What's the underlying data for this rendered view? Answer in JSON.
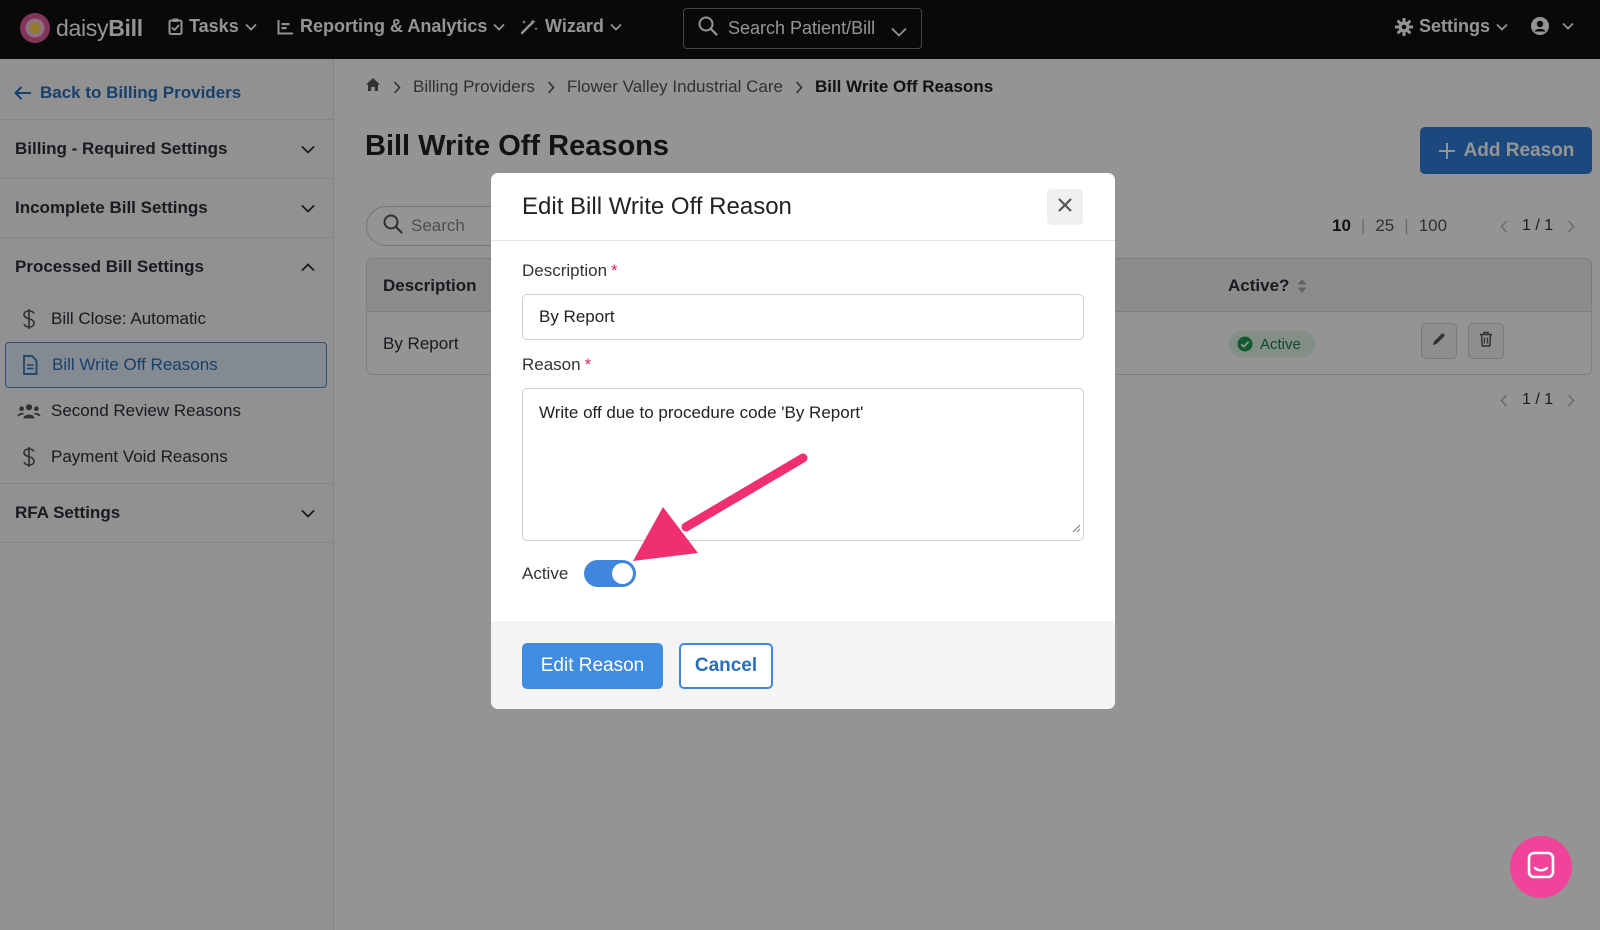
{
  "app": {
    "logo_text_light": "daisy",
    "logo_text_bold": "Bill"
  },
  "topnav": {
    "tasks": "Tasks",
    "reporting": "Reporting & Analytics",
    "wizard": "Wizard",
    "search_placeholder": "Search Patient/Bill",
    "settings": "Settings"
  },
  "sidebar": {
    "back": "Back to Billing Providers",
    "sections": [
      {
        "label": "Billing - Required Settings",
        "expanded": false
      },
      {
        "label": "Incomplete Bill Settings",
        "expanded": false
      },
      {
        "label": "Processed Bill Settings",
        "expanded": true
      },
      {
        "label": "RFA Settings",
        "expanded": false
      }
    ],
    "items": [
      {
        "label": "Bill Close: Automatic",
        "icon": "dollar-icon"
      },
      {
        "label": "Bill Write Off Reasons",
        "icon": "document-icon",
        "active": true
      },
      {
        "label": "Second Review Reasons",
        "icon": "users-icon"
      },
      {
        "label": "Payment Void Reasons",
        "icon": "dollar-icon"
      }
    ]
  },
  "breadcrumb": [
    "Billing Providers",
    "Flower Valley Industrial Care",
    "Bill Write Off Reasons"
  ],
  "page": {
    "title": "Bill Write Off Reasons",
    "add_button": "Add Reason",
    "search_placeholder": "Search",
    "page_sizes": [
      "10",
      "25",
      "100"
    ],
    "selected_page_size": "10",
    "page_indicator": "1 / 1"
  },
  "table": {
    "columns": [
      "Description",
      "Active?"
    ],
    "rows": [
      {
        "description": "By Report",
        "status": "Active"
      }
    ]
  },
  "modal": {
    "title": "Edit Bill Write Off Reason",
    "description_label": "Description",
    "description_value": "By Report",
    "reason_label": "Reason",
    "reason_value": "Write off due to procedure code 'By Report'",
    "required_mark": "*",
    "active_label": "Active",
    "active_on": true,
    "submit": "Edit Reason",
    "cancel": "Cancel"
  },
  "colors": {
    "accent": "#3f86dc",
    "annotation_arrow": "#f0306e",
    "chat_button": "#f0439a",
    "active_badge": "#1e7a42"
  }
}
